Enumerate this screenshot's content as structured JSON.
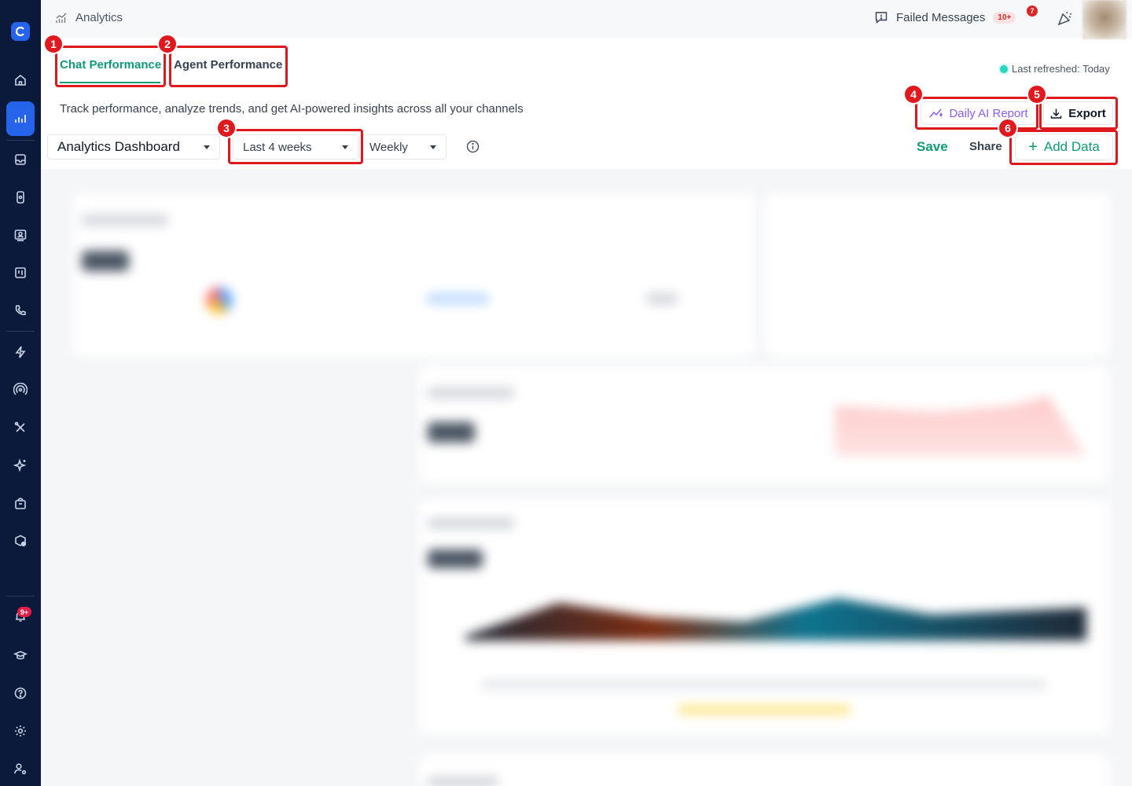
{
  "header": {
    "breadcrumb": "Analytics",
    "failed_messages_label": "Failed Messages",
    "failed_messages_count": "10+",
    "notifications_count": "7"
  },
  "sidebar": {
    "bell_badge": "9+"
  },
  "tabs": [
    {
      "label": "Chat Performance",
      "active": true
    },
    {
      "label": "Agent Performance",
      "active": false
    }
  ],
  "status": {
    "last_refreshed": "Last refreshed: Today"
  },
  "subtitle": "Track performance, analyze trends, and get AI-powered insights across all your channels",
  "toolbar": {
    "daily_ai_report": "Daily AI Report",
    "export": "Export",
    "dashboard_select": "Analytics Dashboard",
    "range_select": "Last 4 weeks",
    "period_select": "Weekly",
    "save": "Save",
    "share": "Share",
    "add_data": "Add Data"
  },
  "annotations": [
    "1",
    "2",
    "3",
    "4",
    "5",
    "6"
  ],
  "colors": {
    "accent": "#0f9a7a",
    "rail": "#0b1a3a",
    "rail_active": "#2563eb",
    "ai_purple": "#8b5cf6",
    "annotation_red": "#e0191e"
  }
}
